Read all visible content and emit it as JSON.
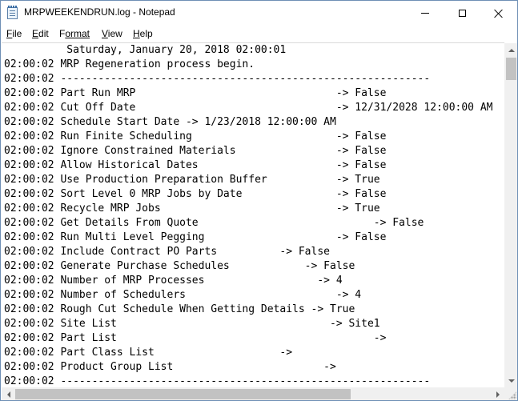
{
  "window": {
    "title": "MRPWEEKENDRUN.log - Notepad"
  },
  "menu": [
    {
      "key": "F",
      "rest": "ile"
    },
    {
      "key": "E",
      "rest": "dit"
    },
    {
      "key": "F",
      "rest": "ormat",
      "prefix": ""
    },
    {
      "key": "V",
      "rest": "iew"
    },
    {
      "key": "H",
      "rest": "elp"
    }
  ],
  "editor": {
    "lines": [
      "          Saturday, January 20, 2018 02:00:01",
      "02:00:02 MRP Regeneration process begin.",
      "02:00:02 -----------------------------------------------------------",
      "02:00:02 Part Run MRP                                -> False",
      "02:00:02 Cut Off Date                                -> 12/31/2028 12:00:00 AM",
      "02:00:02 Schedule Start Date -> 1/23/2018 12:00:00 AM",
      "02:00:02 Run Finite Scheduling                       -> False",
      "02:00:02 Ignore Constrained Materials                -> False",
      "02:00:02 Allow Historical Dates                      -> False",
      "02:00:02 Use Production Preparation Buffer           -> True",
      "02:00:02 Sort Level 0 MRP Jobs by Date               -> False",
      "02:00:02 Recycle MRP Jobs                            -> True",
      "02:00:02 Get Details From Quote                            -> False",
      "02:00:02 Run Multi Level Pegging                     -> False",
      "02:00:02 Include Contract PO Parts          -> False",
      "02:00:02 Generate Purchase Schedules            -> False",
      "02:00:02 Number of MRP Processes                  -> 4",
      "02:00:02 Number of Schedulers                        -> 4",
      "02:00:02 Rough Cut Schedule When Getting Details -> True",
      "02:00:02 Site List                                  -> Site1",
      "02:00:02 Part List                                         ->",
      "02:00:02 Part Class List                    ->",
      "02:00:02 Product Group List                        ->",
      "02:00:02 -----------------------------------------------------------"
    ]
  },
  "icons": {
    "app": "notepad-icon",
    "minimize": "minimize-icon",
    "maximize": "maximize-icon",
    "close": "close-icon"
  },
  "colors": {
    "window_border": "#6e8fb5",
    "scrollbar_track": "#f0f0f0",
    "scrollbar_thumb": "#c2c2c2"
  }
}
